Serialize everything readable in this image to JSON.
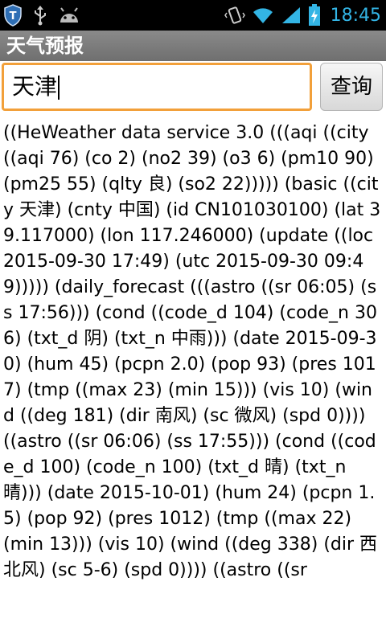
{
  "status_bar": {
    "time": "18:45",
    "icons": [
      "shield-app-icon",
      "usb-icon",
      "android-icon",
      "vibrate-icon",
      "wifi-icon",
      "signal-icon",
      "battery-charging-icon"
    ]
  },
  "app": {
    "title": "天气预报"
  },
  "search": {
    "value": "天津",
    "button_label": "查询"
  },
  "result": {
    "text": "((HeWeather data service 3.0 (((aqi ((city ((aqi 76) (co 2) (no2 39) (o3 6) (pm10 90) (pm25 55) (qlty 良) (so2 22))))) (basic ((city 天津) (cnty 中国) (id CN101030100) (lat 39.117000) (lon 117.246000) (update ((loc 2015-09-30 17:49) (utc 2015-09-30 09:49))))) (daily_forecast (((astro ((sr 06:05) (ss 17:56))) (cond ((code_d 104) (code_n 306) (txt_d 阴) (txt_n 中雨))) (date 2015-09-30) (hum 45) (pcpn 2.0) (pop 93) (pres 1017) (tmp ((max 23) (min 15))) (vis 10) (wind ((deg 181) (dir 南风) (sc 微风) (spd 0)))) ((astro ((sr 06:06) (ss 17:55))) (cond ((code_d 100) (code_n 100) (txt_d 晴) (txt_n 晴))) (date 2015-10-01) (hum 24) (pcpn 1.5) (pop 92) (pres 1012) (tmp ((max 22) (min 13))) (vis 10) (wind ((deg 338) (dir 西北风) (sc 5-6) (spd 0)))) ((astro ((sr"
  }
}
